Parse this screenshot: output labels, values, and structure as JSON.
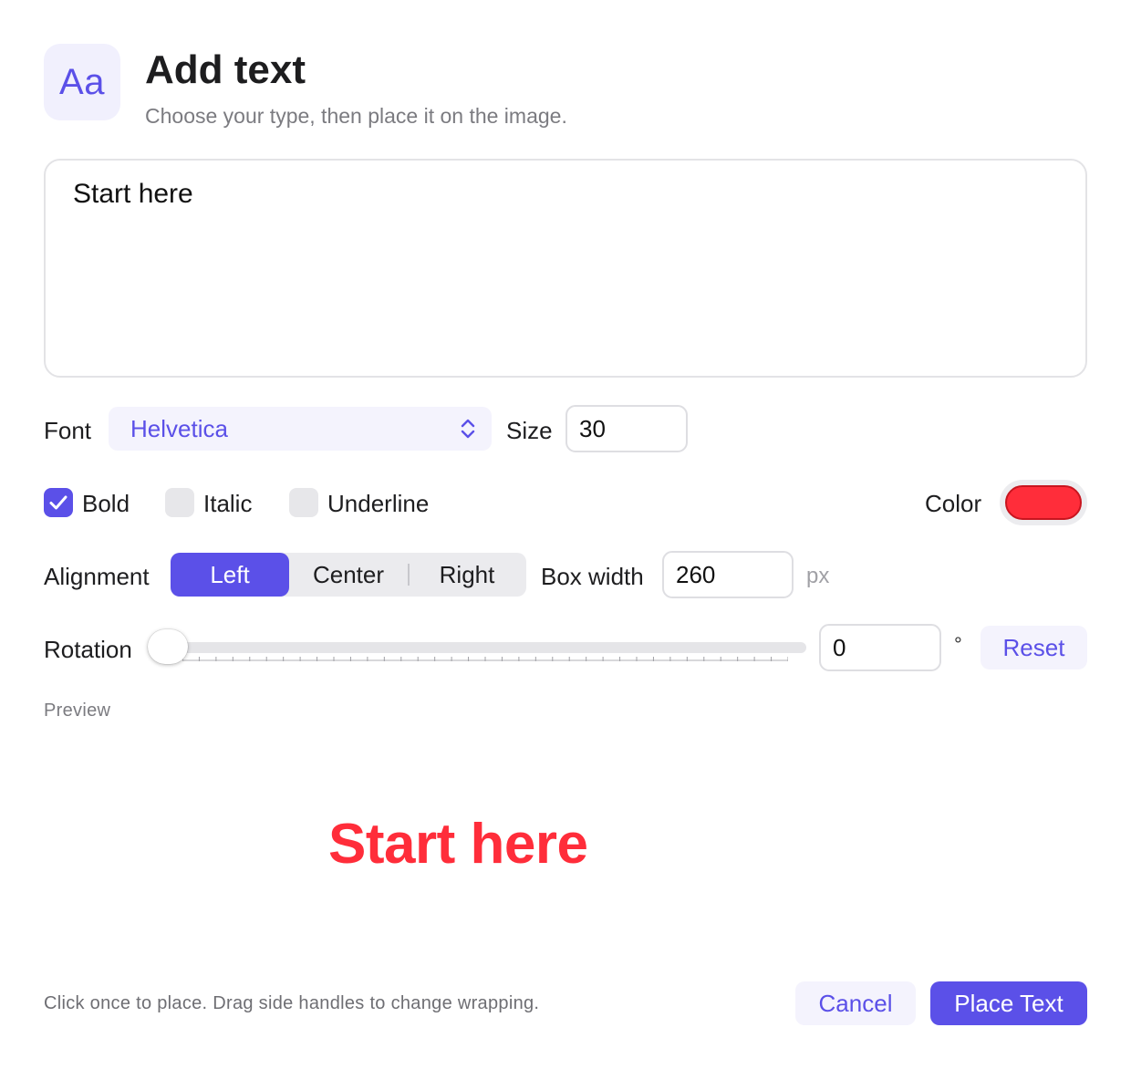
{
  "header": {
    "icon_text": "Aa",
    "title": "Add text",
    "subtitle": "Choose your type, then place it on the image."
  },
  "editor": {
    "text": "Start here"
  },
  "font": {
    "label": "Font",
    "selected": "Helvetica"
  },
  "size": {
    "label": "Size",
    "value": "30"
  },
  "styles": {
    "bold": {
      "label": "Bold",
      "checked": true
    },
    "italic": {
      "label": "Italic",
      "checked": false
    },
    "underline": {
      "label": "Underline",
      "checked": false
    }
  },
  "color": {
    "label": "Color",
    "value": "#ff2d3a"
  },
  "alignment": {
    "label": "Alignment",
    "options": [
      "Left",
      "Center",
      "Right"
    ],
    "selected": "Left"
  },
  "box_width": {
    "label": "Box width",
    "value": "260",
    "unit": "px"
  },
  "rotation": {
    "label": "Rotation",
    "value": "0",
    "unit": "°",
    "reset_label": "Reset"
  },
  "preview": {
    "label": "Preview",
    "text": "Start here"
  },
  "footer": {
    "hint": "Click once to place. Drag side handles to change wrapping.",
    "cancel_label": "Cancel",
    "place_label": "Place Text"
  },
  "colors": {
    "accent": "#5b50e8",
    "accent_light": "#f4f3fd",
    "text_color": "#ff2d3a"
  }
}
